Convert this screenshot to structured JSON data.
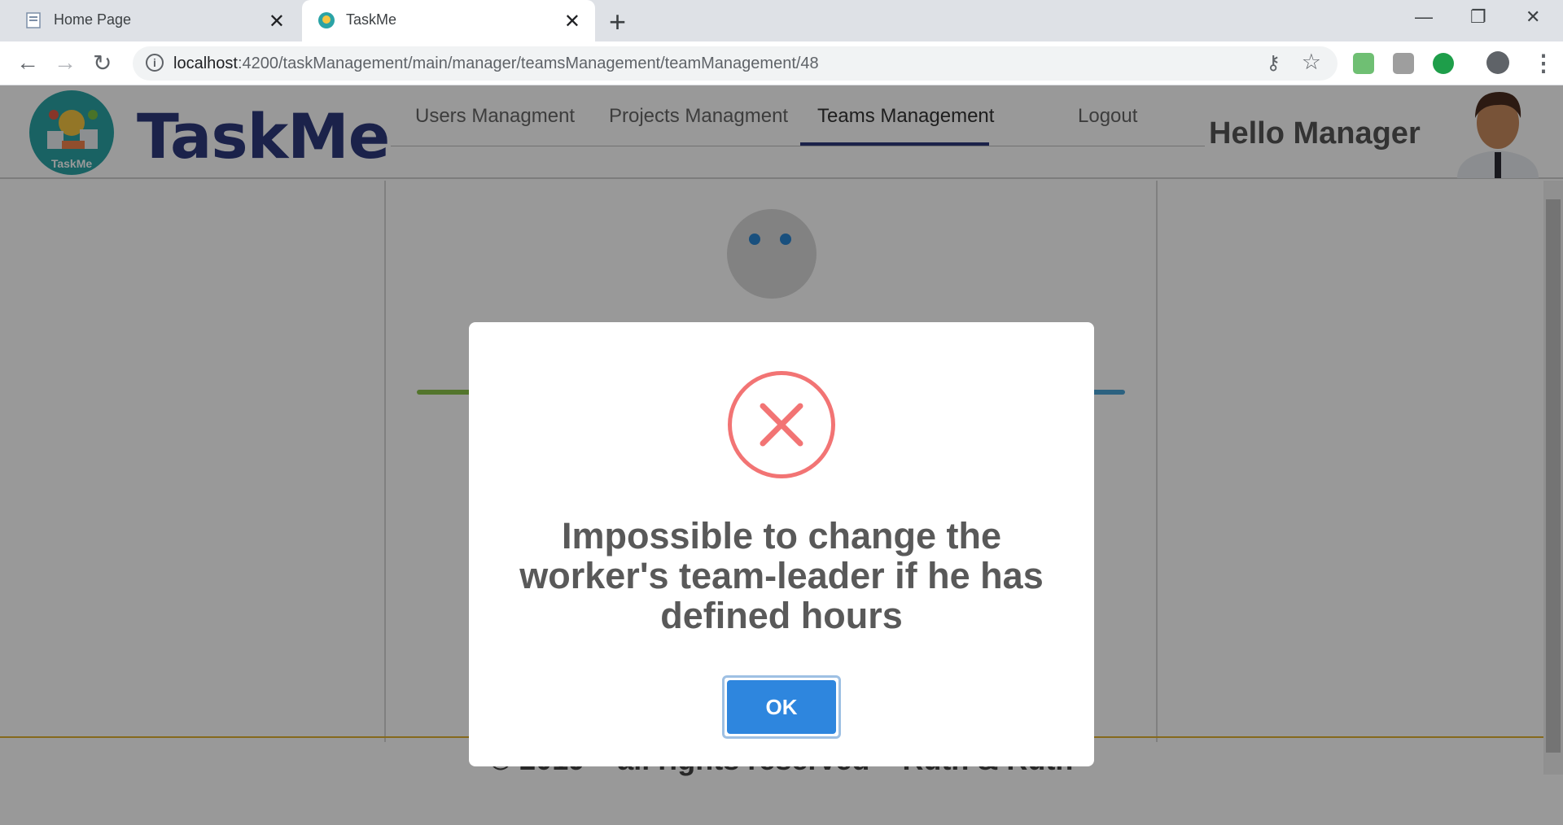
{
  "browser": {
    "tabs": [
      {
        "title": "Home Page",
        "active": false
      },
      {
        "title": "TaskMe",
        "active": true
      }
    ],
    "url_host": "localhost",
    "url_rest": ":4200/taskManagement/main/manager/teamsManagement/teamManagement/48"
  },
  "app": {
    "brand": "TaskMe",
    "logo_text": "TaskMe",
    "nav": [
      {
        "label": "Users Managment"
      },
      {
        "label": "Projects Managment"
      },
      {
        "label": "Teams Management",
        "active": true
      },
      {
        "label": "Logout"
      }
    ],
    "greeting": "Hello Manager",
    "footer": "© 2019 – all rights reserved – Ruth & Ruth"
  },
  "dialog": {
    "message": "Impossible to change the worker's team-leader if he has defined hours",
    "ok_label": "OK",
    "icon": "error-x-icon",
    "icon_color": "#f27474",
    "button_color": "#2e86de"
  }
}
